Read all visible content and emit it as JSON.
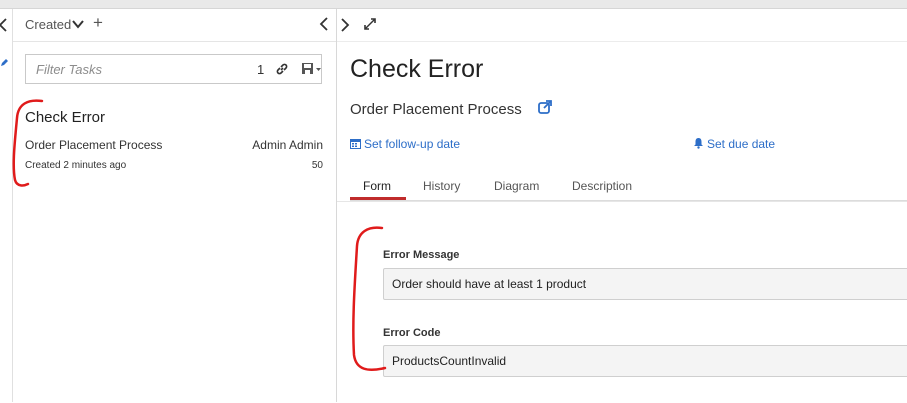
{
  "sidebar": {
    "collapse_icon": "chevron-left-icon",
    "edit_icon": "pencil-icon"
  },
  "task_list": {
    "filter_name": "Created",
    "filter": {
      "placeholder": "Filter Tasks",
      "count": "1"
    },
    "tasks": [
      {
        "name": "Check Error",
        "process": "Order Placement Process",
        "assignee": "Admin Admin",
        "created": "Created 2 minutes ago",
        "priority": "50"
      }
    ]
  },
  "detail": {
    "title": "Check Error",
    "process": "Order Placement Process",
    "follow_up_label": "Set follow-up date",
    "due_date_label": "Set due date",
    "tabs": [
      {
        "label": "Form"
      },
      {
        "label": "History"
      },
      {
        "label": "Diagram"
      },
      {
        "label": "Description"
      }
    ],
    "active_tab": "Form",
    "form": {
      "fields": [
        {
          "label": "Error Message",
          "value": "Order should have at least 1 product"
        },
        {
          "label": "Error Code",
          "value": "ProductsCountInvalid"
        }
      ]
    }
  },
  "colors": {
    "link": "#2d6ec8",
    "active_tab_underline": "#c02b2b",
    "annotation": "#e01b1b"
  }
}
